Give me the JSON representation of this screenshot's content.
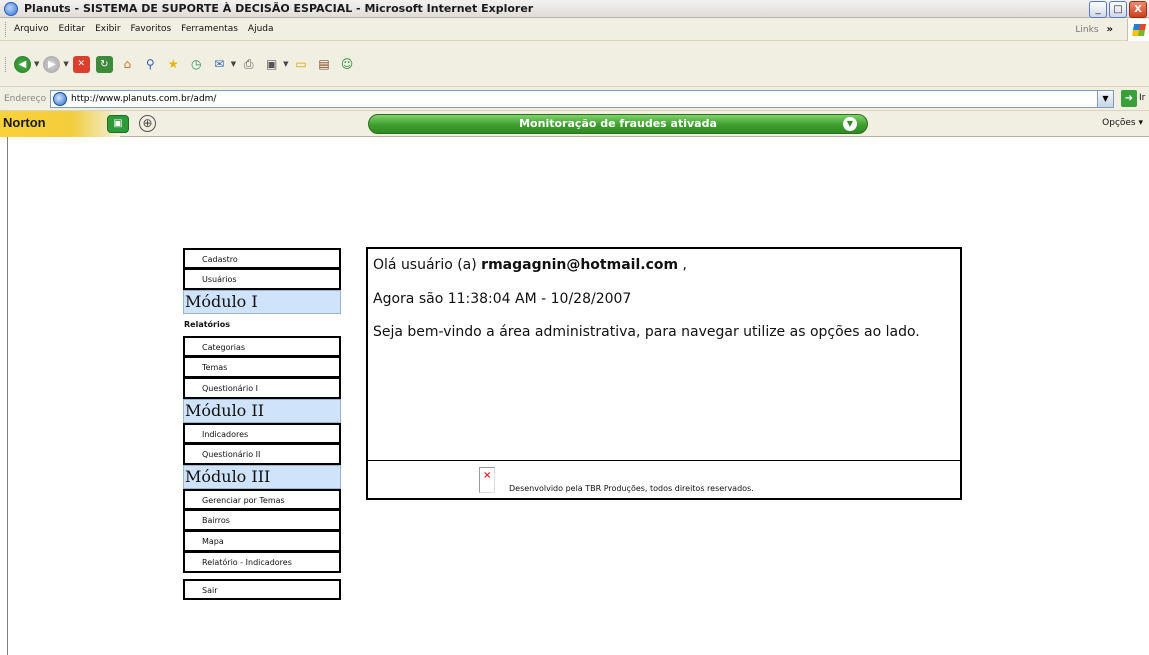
{
  "window": {
    "title": "Planuts - SISTEMA DE SUPORTE À DECISÃO ESPACIAL - Microsoft Internet Explorer",
    "min": "_",
    "max": "□",
    "close": "X"
  },
  "menubar": {
    "items": [
      "Arquivo",
      "Editar",
      "Exibir",
      "Favoritos",
      "Ferramentas",
      "Ajuda"
    ],
    "links_label": "Links",
    "links_chevron": "»"
  },
  "toolbar": {
    "icons": [
      "back-icon",
      "forward-icon",
      "stop-icon",
      "refresh-icon",
      "home-icon",
      "search-icon",
      "favorites-icon",
      "history-icon",
      "mail-icon",
      "print-icon",
      "edit-icon",
      "discuss-icon",
      "research-icon",
      "messenger-icon"
    ]
  },
  "addressbar": {
    "label": "Endereço",
    "url": "http://www.planuts.com.br/adm/",
    "go_label": "Ir"
  },
  "norton": {
    "logo": "Norton",
    "status": "Monitoração de fraudes ativada",
    "options": "Opções ▾"
  },
  "sidemenu": {
    "cadastro": "Cadastro",
    "usuarios": "Usuários",
    "modulo1": "Módulo I",
    "relatorios": "Relatórios",
    "categorias": "Categorias",
    "temas": "Temas",
    "questionario1": "Questionário I",
    "modulo2": "Módulo II",
    "indicadores": "Indicadores",
    "questionario2": "Questionário II",
    "modulo3": "Módulo III",
    "gerenciar": "Gerenciar por Temas",
    "bairros": "Bairros",
    "mapa": "Mapa",
    "relatorio_indicadores": "Relatório - Indicadores",
    "sair": "Sair"
  },
  "content": {
    "greeting_prefix": "Olá usuário (a) ",
    "user_email": "rmagagnin@hotmail.com",
    "greeting_suffix": " ,",
    "now": "Agora são 11:38:04 AM - 10/28/2007",
    "welcome": "Seja bem-vindo a área administrativa, para navegar utilize as opções ao lado.",
    "footer": "Desenvolvido pela TBR Produções, todos direitos reservados."
  }
}
